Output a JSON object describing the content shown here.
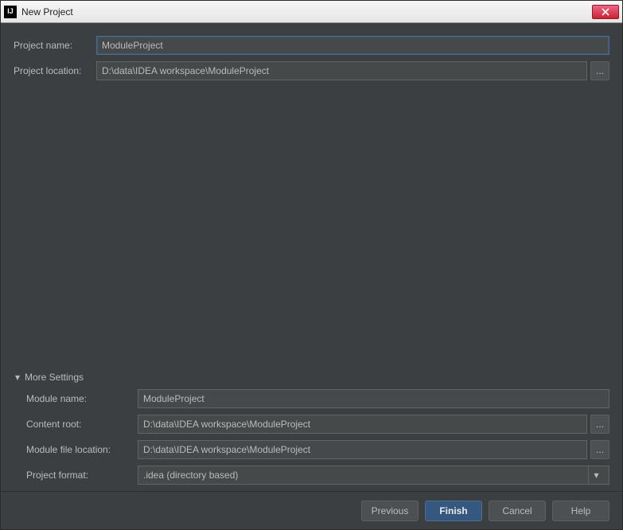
{
  "window": {
    "title": "New Project"
  },
  "fields": {
    "project_name_label": "Project name:",
    "project_name_value": "ModuleProject",
    "project_location_label": "Project location:",
    "project_location_value": "D:\\data\\IDEA workspace\\ModuleProject"
  },
  "more": {
    "toggle_label": "More Settings",
    "module_name_label": "Module name:",
    "module_name_value": "ModuleProject",
    "content_root_label": "Content root:",
    "content_root_value": "D:\\data\\IDEA workspace\\ModuleProject",
    "module_file_loc_label": "Module file location:",
    "module_file_loc_value": "D:\\data\\IDEA workspace\\ModuleProject",
    "project_format_label": "Project format:",
    "project_format_value": ".idea (directory based)"
  },
  "buttons": {
    "browse": "...",
    "previous": "Previous",
    "finish": "Finish",
    "cancel": "Cancel",
    "help": "Help"
  },
  "icons": {
    "app": "IJ"
  }
}
